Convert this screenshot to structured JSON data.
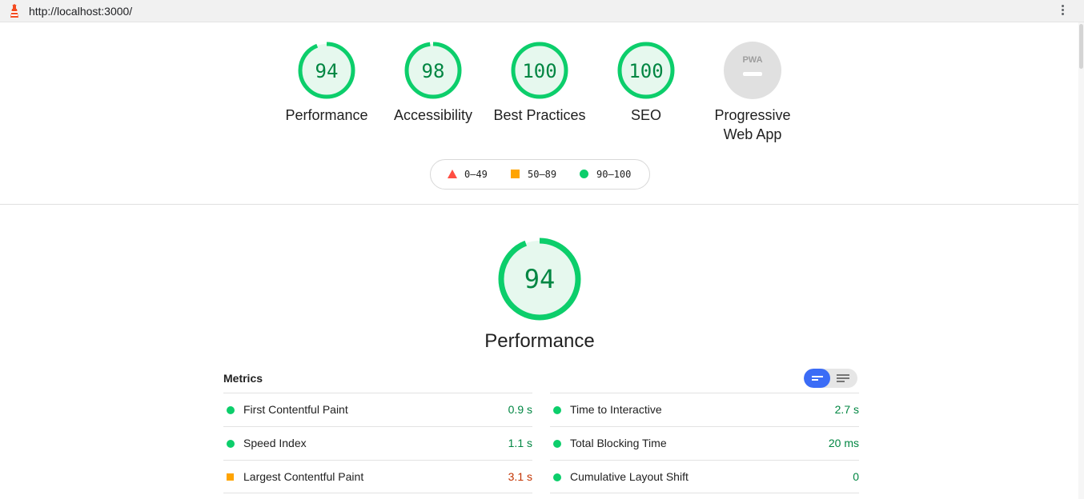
{
  "browser": {
    "url": "http://localhost:3000/",
    "logo_icon": "lighthouse-icon",
    "menu_icon": "kebab-menu-icon"
  },
  "categories": [
    {
      "label": "Performance",
      "score": "94",
      "fill": 0.94
    },
    {
      "label": "Accessibility",
      "score": "98",
      "fill": 0.98
    },
    {
      "label": "Best Practices",
      "score": "100",
      "fill": 1.0
    },
    {
      "label": "SEO",
      "score": "100",
      "fill": 1.0
    },
    {
      "label_line1": "Progressive",
      "label_line2": "Web App",
      "badge_text": "PWA",
      "icon": "pwa-badge-icon"
    }
  ],
  "legend": {
    "fail": "0–49",
    "average": "50–89",
    "pass": "90–100"
  },
  "performance": {
    "score": "94",
    "fill": 0.94,
    "title": "Performance"
  },
  "metrics": {
    "header": "Metrics",
    "toggle_icons": [
      "bar-view-icon",
      "list-view-icon"
    ],
    "left": [
      {
        "name": "First Contentful Paint",
        "value": "0.9 s",
        "rating": "pass"
      },
      {
        "name": "Speed Index",
        "value": "1.1 s",
        "rating": "pass"
      },
      {
        "name": "Largest Contentful Paint",
        "value": "3.1 s",
        "rating": "average"
      }
    ],
    "right": [
      {
        "name": "Time to Interactive",
        "value": "2.7 s",
        "rating": "pass"
      },
      {
        "name": "Total Blocking Time",
        "value": "20 ms",
        "rating": "pass"
      },
      {
        "name": "Cumulative Layout Shift",
        "value": "0",
        "rating": "pass"
      }
    ]
  },
  "colors": {
    "pass": "#0cce6b",
    "pass_text": "#018642",
    "pass_bg": "#e6f8ee",
    "average": "#ffa400",
    "average_text": "#c33300",
    "fail": "#ff4e42",
    "toggle_active": "#3b6cf6"
  }
}
